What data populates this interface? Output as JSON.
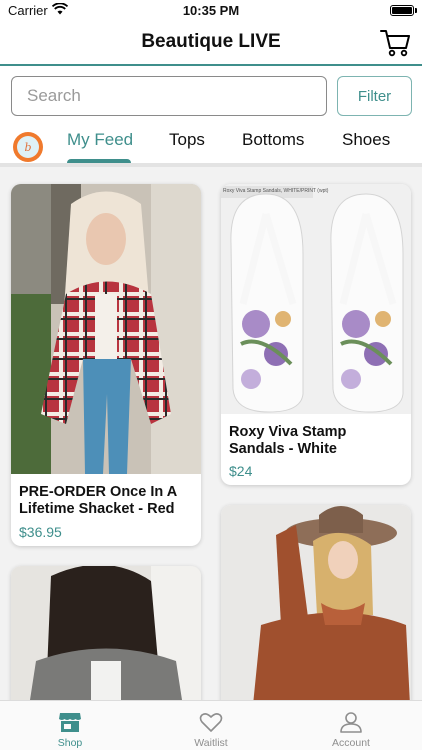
{
  "status_bar": {
    "carrier": "Carrier",
    "time": "10:35 PM"
  },
  "nav": {
    "title": "Beautique LIVE",
    "cart_icon": "cart-icon"
  },
  "search": {
    "placeholder": "Search",
    "value": ""
  },
  "filter_label": "Filter",
  "tabs": [
    {
      "label": "My Feed",
      "active": true
    },
    {
      "label": "Tops",
      "active": false
    },
    {
      "label": "Bottoms",
      "active": false
    },
    {
      "label": "Shoes",
      "active": false
    }
  ],
  "products": [
    {
      "name": "PRE-ORDER Once In A Lifetime Shacket - Red",
      "price": "$36.95"
    },
    {
      "name": "Roxy Viva Stamp Sandals - White",
      "price": "$24",
      "image_caption": "Roxy Viva Stamp Sandals, WHITE/PRINT (wpt)"
    },
    {
      "name": "",
      "price": ""
    },
    {
      "name": "",
      "price": ""
    }
  ],
  "tabbar": [
    {
      "label": "Shop",
      "icon": "shop-icon",
      "active": true
    },
    {
      "label": "Waitlist",
      "icon": "heart-icon",
      "active": false
    },
    {
      "label": "Account",
      "icon": "person-icon",
      "active": false
    }
  ],
  "colors": {
    "accent": "#3f8f8c",
    "feed_bg": "#f2f2f2",
    "logo_orange": "#f07a2d"
  }
}
